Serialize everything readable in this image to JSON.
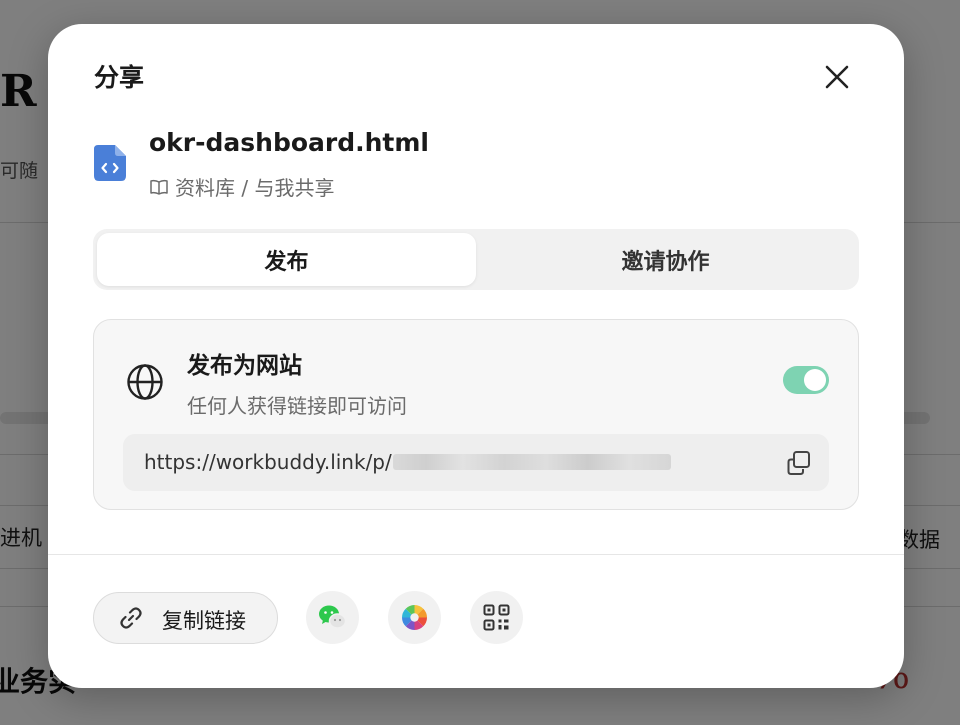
{
  "background": {
    "title_fragment": "R",
    "subtitle_fragment": "可随",
    "left_cell_fragment": "进机",
    "right_cell_fragment": "数据",
    "bottom_left_fragment": "业务实",
    "bottom_right_fragment": "%"
  },
  "modal": {
    "title": "分享",
    "file": {
      "name": "okr-dashboard.html",
      "path": "资料库 / 与我共享"
    },
    "tabs": [
      {
        "label": "发布",
        "active": true
      },
      {
        "label": "邀请协作",
        "active": false
      }
    ],
    "publish": {
      "title": "发布为网站",
      "description": "任何人获得链接即可访问",
      "enabled": true,
      "url": "https://workbuddy.link/p/"
    },
    "footer": {
      "copy_link_label": "复制链接"
    }
  },
  "colors": {
    "toggle_on": "#7ed3b2",
    "file_icon": "#4a7fd8",
    "wechat_green": "#2dc84d",
    "accent_red": "#b8312f"
  },
  "icons": [
    "close-icon",
    "html-file-icon",
    "book-icon",
    "globe-icon",
    "copy-icon",
    "link-icon",
    "wechat-icon",
    "moments-icon",
    "qrcode-icon"
  ]
}
